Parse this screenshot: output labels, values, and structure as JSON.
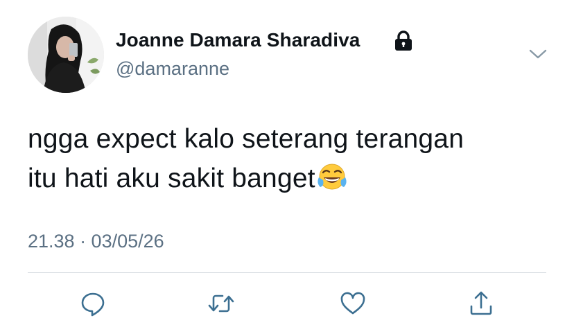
{
  "profile": {
    "display_name": "Joanne Damara Sharadiva",
    "handle": "@damaranne",
    "protected_icon": "lock-icon",
    "avatar": "profile-photo"
  },
  "tweet": {
    "lines": [
      "ngga expect kalo seterang terangan",
      "itu hati aku sakit banget"
    ],
    "emoji": "face-with-tears-of-joy-emoji",
    "timestamp": "21.38 · 03/05/26"
  },
  "actions": [
    {
      "name": "reply",
      "icon": "reply-icon"
    },
    {
      "name": "retweet",
      "icon": "retweet-icon"
    },
    {
      "name": "like",
      "icon": "heart-icon"
    },
    {
      "name": "share",
      "icon": "share-icon"
    }
  ],
  "menu": {
    "icon": "chevron-down-icon"
  },
  "colors": {
    "text": "#0f1419",
    "secondary": "#5b7083",
    "icon": "#3c6f91",
    "divider": "#d6dbe0",
    "background": "#ffffff"
  }
}
